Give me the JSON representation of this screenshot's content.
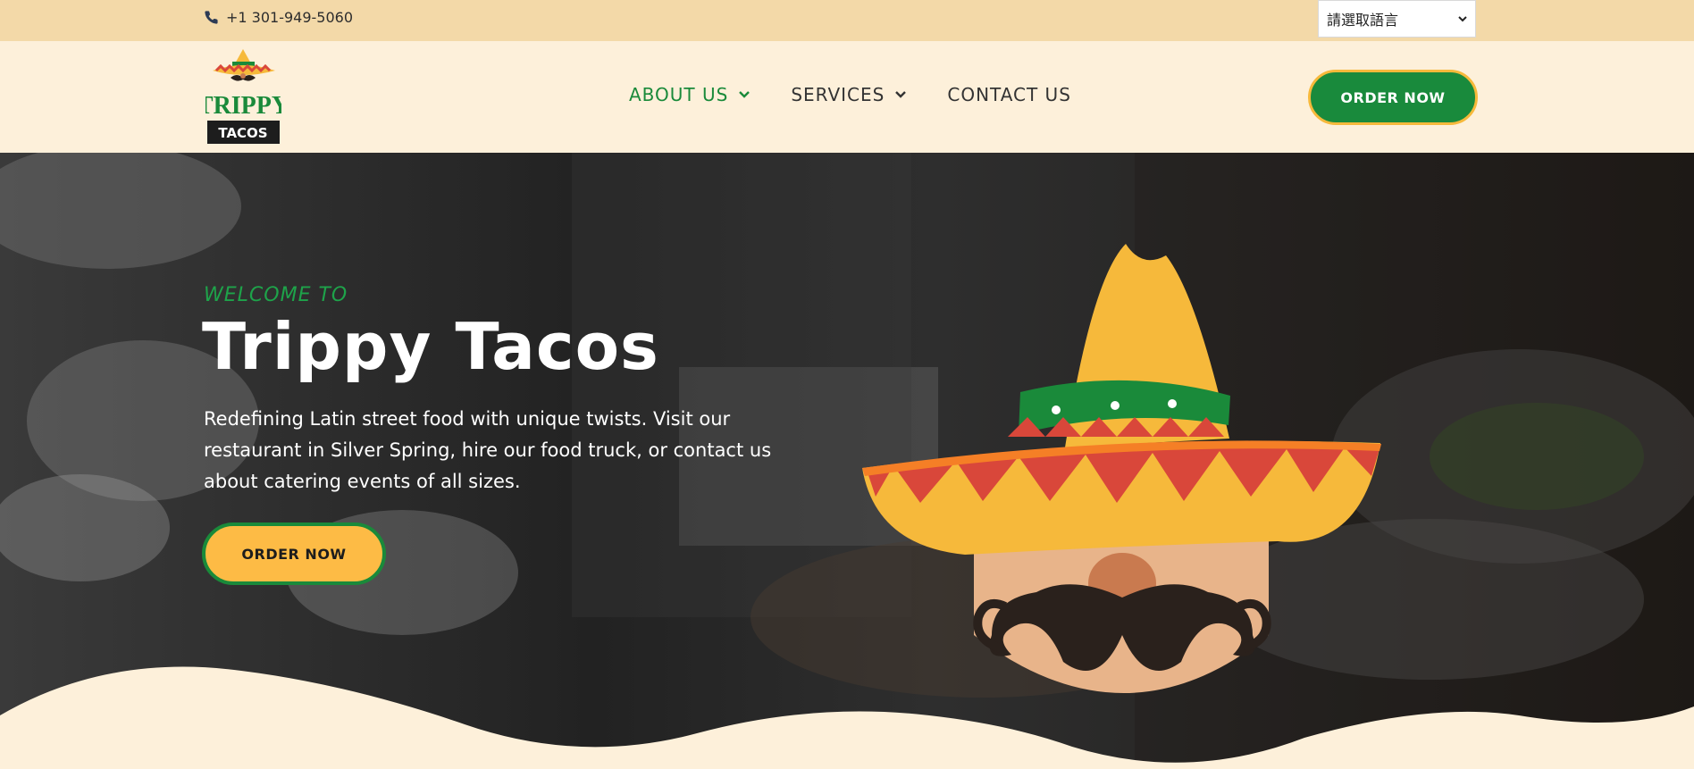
{
  "topbar": {
    "phone": "+1 301-949-5060",
    "phone_icon": "phone-icon",
    "language_select": "請選取語言"
  },
  "header": {
    "logo_text_top": "TRIPPY",
    "logo_text_bottom": "TACOS",
    "nav": [
      {
        "label": "ABOUT US",
        "has_dropdown": true,
        "active": true
      },
      {
        "label": "SERVICES",
        "has_dropdown": true,
        "active": false
      },
      {
        "label": "CONTACT US",
        "has_dropdown": false,
        "active": false
      }
    ],
    "order_button": "ORDER NOW"
  },
  "hero": {
    "kicker": "WELCOME TO",
    "title": "Trippy Tacos",
    "text": "Redefining Latin street food with unique twists. Visit our restaurant in Silver Spring, hire our food truck, or contact us about catering events of all sizes.",
    "order_button": "ORDER NOW"
  },
  "colors": {
    "topbar": "#f3d9a8",
    "background": "#fdf0da",
    "brand_green": "#198a3c",
    "brand_yellow": "#fdbb45",
    "brand_red": "#d9473a"
  }
}
